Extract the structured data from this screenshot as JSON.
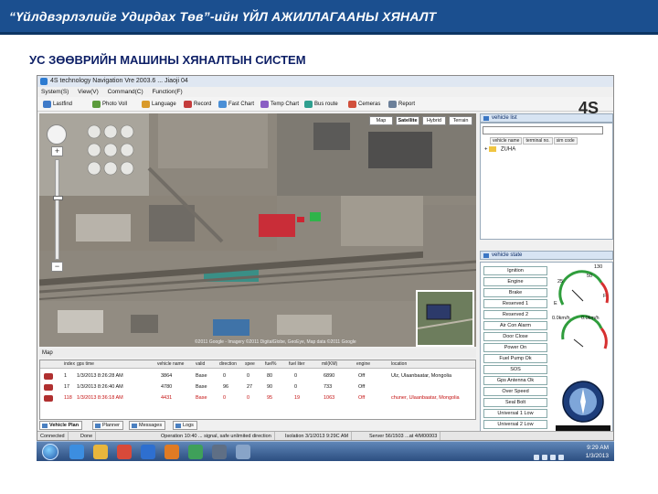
{
  "slide": {
    "header_title": "“Үйлдвэрлэлийг Удирдах Төв”-ийн ҮЙЛ АЖИЛЛАГААНЫ ХЯНАЛТ",
    "subtitle": "УС ЗӨӨВРИЙН МАШИНЫ ХЯНАЛТЫН СИСТЕМ"
  },
  "window": {
    "title": "4S technology Navigation Vre 2003.6 ... Jiaoji 04",
    "menu": [
      "System(S)",
      "View(V)",
      "Command(C)",
      "Function(F)"
    ],
    "toolbar": [
      "Lastfind",
      "Photo Voll",
      "Language",
      "Record",
      "Fast Chart",
      "Temp Chart",
      "Bus route",
      "Cemeras",
      "Report"
    ],
    "logo_text": "4S"
  },
  "map": {
    "tabs": [
      "Map",
      "Satellite",
      "Hybrid",
      "Terrain"
    ],
    "active_tab": "Satellite",
    "attribution": "©2011 Google - Imagery ©2011 DigitalGlobe, GeoEye, Map data ©2011 Google",
    "zoom_level_fraction": 0.62,
    "status_label": "Map"
  },
  "vehicle_list": {
    "header": "vehicle list",
    "columns": [
      "vehicle name",
      "terminal no.",
      "sim code"
    ],
    "node": "ZUHA"
  },
  "vehicle_state": {
    "header": "vehicle state",
    "buttons": [
      "Ignition",
      "Engine",
      "Brake",
      "Reserved 1",
      "Reserved 2",
      "Air Con Alarm",
      "Door Close",
      "Power On",
      "Fuel Pump Ok",
      "SOS",
      "Gps Antenna Ok",
      "Over Speed",
      "Seal Bolt",
      "Universal 1 Low",
      "Universal 2 Low"
    ],
    "gauge_labels": [
      "130",
      "25",
      "50",
      "E",
      "F",
      "0.0km/h",
      "0.0km/h"
    ]
  },
  "grid": {
    "columns": [
      "index",
      "gps time",
      "vehicle name",
      "valid",
      "direction",
      "spee",
      "fuel%",
      "fuel liter",
      "mil(KM)",
      "engine",
      "location"
    ],
    "rows": [
      {
        "index": "1",
        "time": "1/3/2013 8:26:28 AM",
        "name": "3864",
        "valid": "Base",
        "dir": "0",
        "spee": "0",
        "fuel": "80",
        "liter": "0",
        "km": "6890",
        "engine": "Off",
        "loc": "Ulz, Ulaanbaatar, Mongolia",
        "alert": false
      },
      {
        "index": "17",
        "time": "1/3/2013 8:26:40 AM",
        "name": "4780",
        "valid": "Base",
        "dir": "96",
        "spee": "27",
        "fuel": "90",
        "liter": "0",
        "km": "733",
        "engine": "Off",
        "loc": "",
        "alert": false
      },
      {
        "index": "118",
        "time": "1/3/2013 8:36:18 AM",
        "name": "4431",
        "valid": "Base",
        "dir": "0",
        "spee": "0",
        "fuel": "95",
        "liter": "19",
        "km": "1063",
        "engine": "Off",
        "loc": "chuner, Ulaanbaatar, Mongolia",
        "alert": true
      }
    ]
  },
  "bottom_tabs": [
    "Vehicle Plan",
    "Planner",
    "Messages",
    "Logs"
  ],
  "status_bar": [
    "Connected",
    "Done",
    "Operation 10:40 ... signal, safe unlimited direction",
    "Isolation 3/1/2013 9:29C AM",
    "Server 56/1503 ...at 4/M00003"
  ],
  "taskbar": {
    "time": "9:29 AM",
    "date": "1/3/2013"
  },
  "colors": {
    "header_bg": "#1b4f8f",
    "subtitle": "#0d1f66",
    "logo_accent": "#e0641b",
    "alert_text": "#c41010"
  }
}
